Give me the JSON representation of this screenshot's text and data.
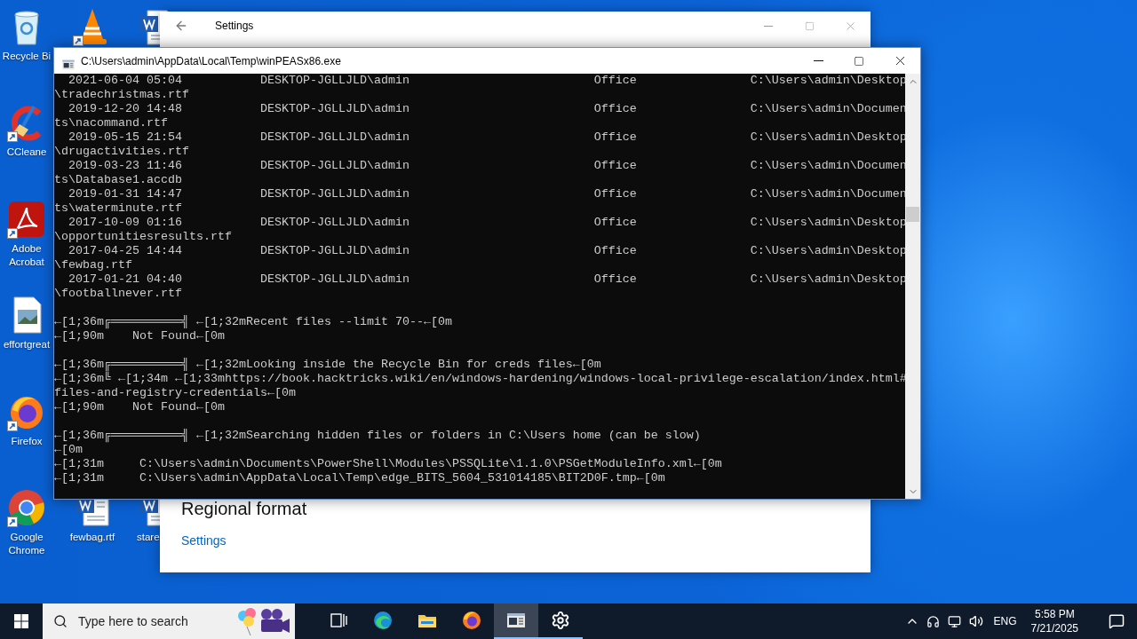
{
  "desktop": {
    "columns": [
      {
        "icons": [
          {
            "kind": "recycle-bin",
            "label": "Recycle Bi",
            "shortcut": false
          },
          {
            "kind": "ccleaner",
            "label": "CCleane",
            "shortcut": true
          },
          {
            "kind": "pdf",
            "label": "Adobe Acrobat",
            "shortcut": true
          },
          {
            "kind": "image-file",
            "label": "effortgreat",
            "shortcut": false
          },
          {
            "kind": "firefox",
            "label": "Firefox",
            "shortcut": true
          },
          {
            "kind": "chrome",
            "label": "Google Chrome",
            "shortcut": true
          }
        ]
      },
      {
        "icons": [
          {
            "kind": "vlc",
            "shortcut": true
          },
          {
            "kind": "word-doc",
            "label": "fewbag.rtf",
            "shortcut": false
          }
        ]
      },
      {
        "icons": [
          {
            "kind": "word-doc",
            "shortcut": false
          },
          {
            "kind": "word-doc",
            "label": "stare",
            "shortcut": false
          }
        ]
      }
    ]
  },
  "settings_window": {
    "title": "Settings",
    "heading": "Regional format",
    "link": "Settings"
  },
  "console_window": {
    "title": "C:\\Users\\admin\\AppData\\Local\\Temp\\winPEASx86.exe",
    "records": [
      {
        "date": "2021-06-04 05:04",
        "owner": "DESKTOP-JGLLJLD\\admin",
        "program": "Office",
        "path": "C:\\Users\\admin\\Desktop",
        "path_continued": "\\tradechristmas.rtf"
      },
      {
        "date": "2019-12-20 14:48",
        "owner": "DESKTOP-JGLLJLD\\admin",
        "program": "Office",
        "path": "C:\\Users\\admin\\Documen",
        "path_continued": "ts\\nacommand.rtf"
      },
      {
        "date": "2019-05-15 21:54",
        "owner": "DESKTOP-JGLLJLD\\admin",
        "program": "Office",
        "path": "C:\\Users\\admin\\Desktop",
        "path_continued": "\\drugactivities.rtf"
      },
      {
        "date": "2019-03-23 11:46",
        "owner": "DESKTOP-JGLLJLD\\admin",
        "program": "Office",
        "path": "C:\\Users\\admin\\Documen",
        "path_continued": "ts\\Database1.accdb"
      },
      {
        "date": "2019-01-31 14:47",
        "owner": "DESKTOP-JGLLJLD\\admin",
        "program": "Office",
        "path": "C:\\Users\\admin\\Documen",
        "path_continued": "ts\\waterminute.rtf"
      },
      {
        "date": "2017-10-09 01:16",
        "owner": "DESKTOP-JGLLJLD\\admin",
        "program": "Office",
        "path": "C:\\Users\\admin\\Desktop",
        "path_continued": "\\opportunitiesresults.rtf"
      },
      {
        "date": "2017-04-25 14:44",
        "owner": "DESKTOP-JGLLJLD\\admin",
        "program": "Office",
        "path": "C:\\Users\\admin\\Desktop",
        "path_continued": "\\fewbag.rtf"
      },
      {
        "date": "2017-01-21 04:40",
        "owner": "DESKTOP-JGLLJLD\\admin",
        "program": "Office",
        "path": "C:\\Users\\admin\\Desktop",
        "path_continued": "\\footballnever.rtf"
      }
    ],
    "sections": [
      {
        "lines": [
          "←[1;36m╔══════════╣ ←[1;32mRecent files --limit 70--←[0m",
          "←[1;90m    Not Found←[0m"
        ]
      },
      {
        "lines": [
          "←[1;36m╔══════════╣ ←[1;32mLooking inside the Recycle Bin for creds files←[0m",
          "←[1;36m╚ ←[1;34m ←[1;33mhttps://book.hacktricks.wiki/en/windows-hardening/windows-local-privilege-escalation/index.html#",
          "files-and-registry-credentials←[0m",
          "←[1;90m    Not Found←[0m"
        ]
      },
      {
        "lines": [
          "←[1;36m╔══════════╣ ←[1;32mSearching hidden files or folders in C:\\Users home (can be slow)",
          "←[0m",
          "←[1;31m     C:\\Users\\admin\\Documents\\PowerShell\\Modules\\PSSQLite\\1.1.0\\PSGetModuleInfo.xml←[0m",
          "←[1;31m     C:\\Users\\admin\\AppData\\Local\\Temp\\edge_BITS_5604_531014185\\BIT2D0F.tmp←[0m"
        ]
      }
    ]
  },
  "taskbar": {
    "search": {
      "placeholder": "Type here to search"
    },
    "apps": [
      {
        "kind": "task-view",
        "open": false,
        "selected": false
      },
      {
        "kind": "edge",
        "open": false,
        "selected": false
      },
      {
        "kind": "explorer",
        "open": false,
        "selected": false
      },
      {
        "kind": "firefox",
        "open": false,
        "selected": false
      },
      {
        "kind": "console",
        "open": true,
        "selected": true
      },
      {
        "kind": "settings",
        "open": true,
        "selected": false
      }
    ],
    "tray": {
      "language": "ENG",
      "time": "5:58 PM",
      "date": "7/21/2025"
    }
  }
}
